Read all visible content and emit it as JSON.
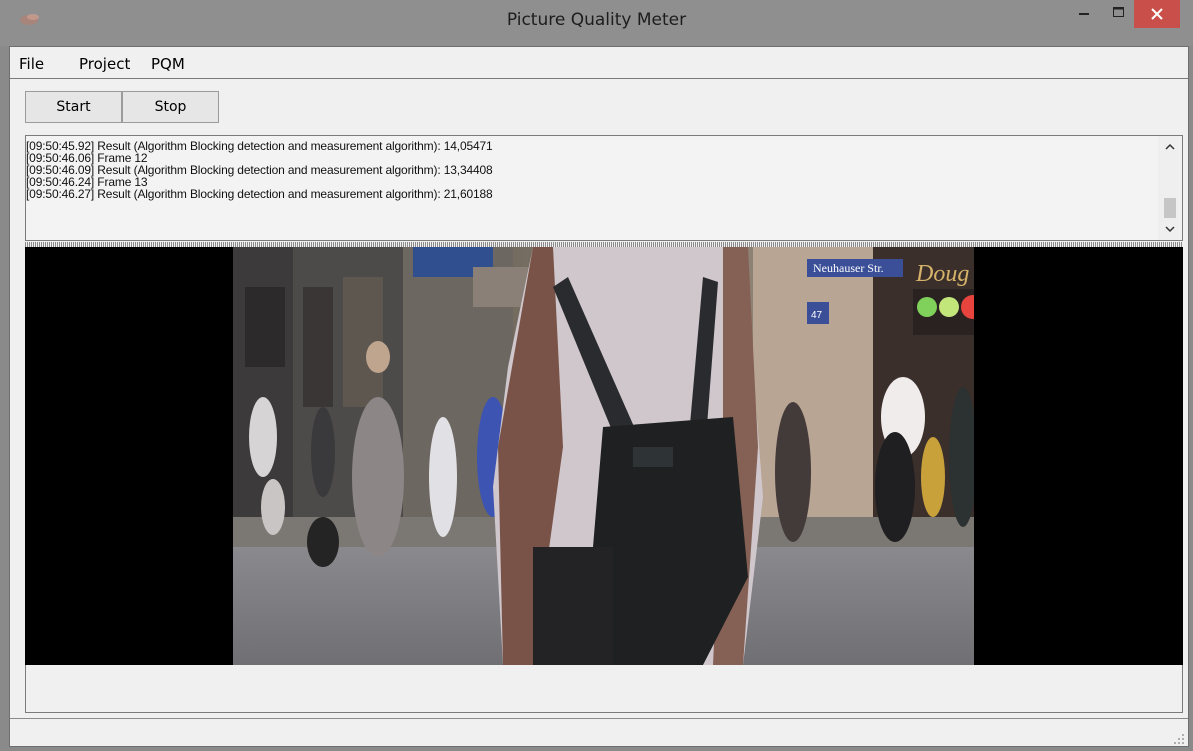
{
  "window": {
    "title": "Picture Quality Meter",
    "controls": {
      "minimize": "–",
      "maximize": "□",
      "close": "✕"
    },
    "icon": "app-icon"
  },
  "menu": [
    {
      "label": "File"
    },
    {
      "label": "Project"
    },
    {
      "label": "PQM"
    }
  ],
  "toolbar": {
    "start_label": "Start",
    "stop_label": "Stop"
  },
  "log": {
    "lines": [
      "[09:50:45.92] Result (Algorithm Blocking detection and measurement algorithm): 14,05471",
      "[09:50:46.06] Frame 12",
      "[09:50:46.09] Result (Algorithm Blocking detection and measurement algorithm): 13,34408",
      "[09:50:46.24] Frame 13",
      "[09:50:46.27] Result (Algorithm Blocking detection and measurement algorithm): 21,60188"
    ]
  },
  "video": {
    "street_sign": "Neuhauser Str.",
    "shop_sign": "Doug",
    "house_number": "47"
  },
  "colors": {
    "close_button": "#c84f4a",
    "window_chrome": "#8f8f8f",
    "client_background": "#f0f0f0"
  }
}
